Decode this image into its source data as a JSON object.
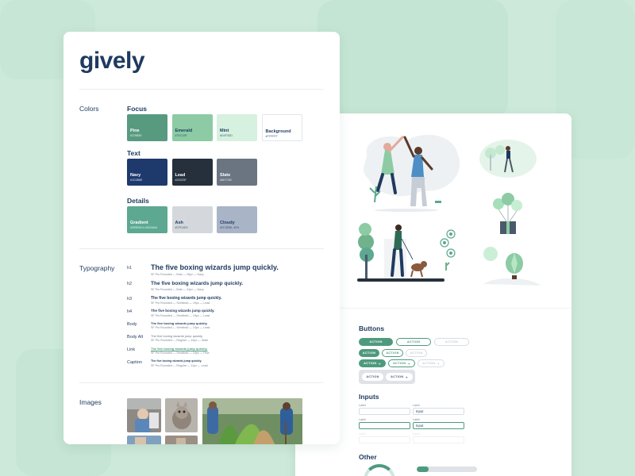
{
  "brand": {
    "logo": "gively"
  },
  "colors": {
    "label": "Colors",
    "groups": [
      {
        "title": "Focus",
        "swatches": [
          {
            "name": "Pine",
            "hex": "#376B55",
            "color": "#589a80",
            "text": "light"
          },
          {
            "name": "Emerald",
            "hex": "#7EC29F",
            "color": "#8ccba4",
            "text": "dark"
          },
          {
            "name": "Mint",
            "hex": "#D4F3DD",
            "color": "#d6f1df",
            "text": "dark"
          },
          {
            "name": "Background",
            "hex": "#FFFFFF",
            "color": "#ffffff",
            "text": "dark"
          }
        ]
      },
      {
        "title": "Text",
        "swatches": [
          {
            "name": "Navy",
            "hex": "#1D3B6E",
            "color": "#1e3a6d",
            "text": "light"
          },
          {
            "name": "Lead",
            "hex": "#24323F",
            "color": "#26303d",
            "text": "light"
          },
          {
            "name": "Slate",
            "hex": "#6D7783",
            "color": "#6b7582",
            "text": "light"
          }
        ]
      },
      {
        "title": "Details",
        "swatches": [
          {
            "name": "Gradient",
            "hex": "#359E85 to #52A5A4",
            "color": "#5ca890",
            "text": "light"
          },
          {
            "name": "Ash",
            "hex": "#CFD4D9",
            "color": "#d4d8dc",
            "text": "dark"
          },
          {
            "name": "Cloudy",
            "hex": "#2C3E86, 40%",
            "color": "#a9b4c7",
            "text": "dark"
          }
        ]
      }
    ]
  },
  "typography": {
    "label": "Typography",
    "rows": [
      {
        "tag": "h1",
        "sample": "The five boxing wizards jump quickly.",
        "meta": "SF Pro Rounded — Bold — 26px — Navy"
      },
      {
        "tag": "h2",
        "sample": "The five boxing wizards jump quickly.",
        "meta": "SF Pro Rounded — Bold — 24px — Navy"
      },
      {
        "tag": "h3",
        "sample": "The five boxing wizards jump quickly.",
        "meta": "SF Pro Rounded — Semibold — 19px — Lead"
      },
      {
        "tag": "h4",
        "sample": "The five boxing wizards jump quickly.",
        "meta": "SF Pro Rounded — Semibold — 19px — Lead"
      },
      {
        "tag": "Body",
        "sample": "The five boxing wizards jump quickly.",
        "meta": "SF Pro Rounded — Semibold — 15px — Lead"
      },
      {
        "tag": "Body Alt",
        "sample": "The five boxing wizards jump quickly.",
        "meta": "SF Pro Rounded — Regular — 15px — Slate"
      },
      {
        "tag": "Link",
        "sample": "The five boxing wizards jump quickly.",
        "meta": "SF Pro Rounded — Semibold — 15px — Pine"
      },
      {
        "tag": "Caption",
        "sample": "The five boxing wizards jump quickly.",
        "meta": "SF Pro Rounded — Regular — 11px — Lead"
      }
    ]
  },
  "images": {
    "label": "Images"
  },
  "buttons": {
    "label": "Buttons",
    "action": "ACTION",
    "arrow": "➔"
  },
  "inputs": {
    "label": "Inputs",
    "field_label": "Label",
    "field_value": "Input"
  },
  "other": {
    "label": "Other",
    "progress": 0.2
  },
  "palette": {
    "pine": "#4e9a7e",
    "navy": "#1f3a5f"
  }
}
